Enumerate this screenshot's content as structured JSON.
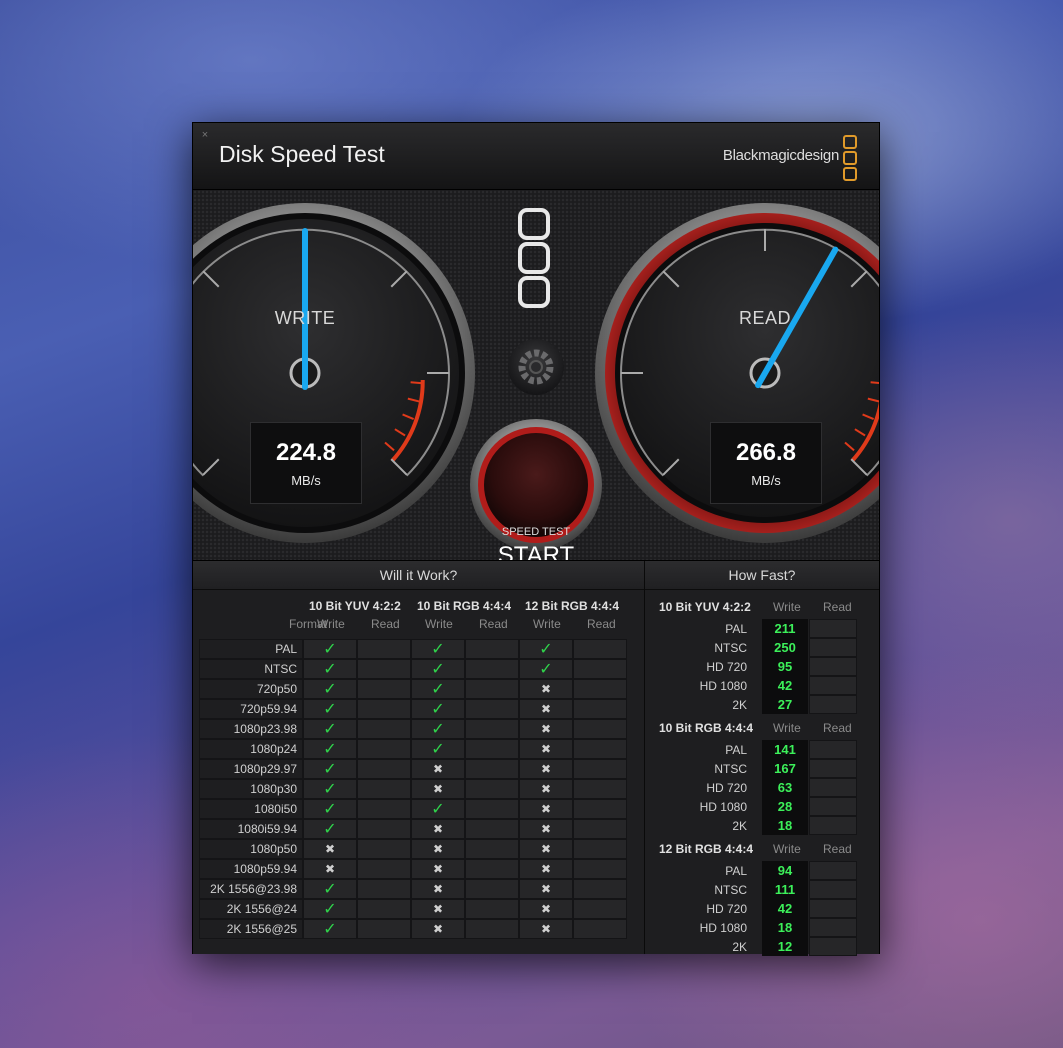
{
  "app": {
    "title": "Disk Speed Test",
    "brand": "Blackmagicdesign",
    "close_icon": "×"
  },
  "gauges": {
    "write": {
      "label": "WRITE",
      "value": "224.8",
      "unit": "MB/s",
      "needle_fraction": 0.5
    },
    "read": {
      "label": "READ",
      "value": "266.8",
      "unit": "MB/s",
      "needle_fraction": 0.61
    }
  },
  "start_button": {
    "small": "SPEED TEST",
    "big": "START"
  },
  "will_it_work": {
    "title": "Will it Work?",
    "groups": [
      "10 Bit YUV 4:2:2",
      "10 Bit RGB 4:4:4",
      "12 Bit RGB 4:4:4"
    ],
    "format_label": "Format",
    "write_label": "Write",
    "read_label": "Read",
    "rows": [
      {
        "format": "PAL",
        "results": [
          true,
          true,
          true
        ]
      },
      {
        "format": "NTSC",
        "results": [
          true,
          true,
          true
        ]
      },
      {
        "format": "720p50",
        "results": [
          true,
          true,
          false
        ]
      },
      {
        "format": "720p59.94",
        "results": [
          true,
          true,
          false
        ]
      },
      {
        "format": "1080p23.98",
        "results": [
          true,
          true,
          false
        ]
      },
      {
        "format": "1080p24",
        "results": [
          true,
          true,
          false
        ]
      },
      {
        "format": "1080p29.97",
        "results": [
          true,
          false,
          false
        ]
      },
      {
        "format": "1080p30",
        "results": [
          true,
          false,
          false
        ]
      },
      {
        "format": "1080i50",
        "results": [
          true,
          true,
          false
        ]
      },
      {
        "format": "1080i59.94",
        "results": [
          true,
          false,
          false
        ]
      },
      {
        "format": "1080p50",
        "results": [
          false,
          false,
          false
        ]
      },
      {
        "format": "1080p59.94",
        "results": [
          false,
          false,
          false
        ]
      },
      {
        "format": "2K 1556@23.98",
        "results": [
          true,
          false,
          false
        ]
      },
      {
        "format": "2K 1556@24",
        "results": [
          true,
          false,
          false
        ]
      },
      {
        "format": "2K 1556@25",
        "results": [
          true,
          false,
          false
        ]
      }
    ]
  },
  "how_fast": {
    "title": "How Fast?",
    "write_label": "Write",
    "read_label": "Read",
    "groups": [
      {
        "name": "10 Bit YUV 4:2:2",
        "rows": [
          {
            "format": "PAL",
            "write": "211"
          },
          {
            "format": "NTSC",
            "write": "250"
          },
          {
            "format": "HD 720",
            "write": "95"
          },
          {
            "format": "HD 1080",
            "write": "42"
          },
          {
            "format": "2K",
            "write": "27"
          }
        ]
      },
      {
        "name": "10 Bit RGB 4:4:4",
        "rows": [
          {
            "format": "PAL",
            "write": "141"
          },
          {
            "format": "NTSC",
            "write": "167"
          },
          {
            "format": "HD 720",
            "write": "63"
          },
          {
            "format": "HD 1080",
            "write": "28"
          },
          {
            "format": "2K",
            "write": "18"
          }
        ]
      },
      {
        "name": "12 Bit RGB 4:4:4",
        "rows": [
          {
            "format": "PAL",
            "write": "94"
          },
          {
            "format": "NTSC",
            "write": "111"
          },
          {
            "format": "HD 720",
            "write": "42"
          },
          {
            "format": "HD 1080",
            "write": "18"
          },
          {
            "format": "2K",
            "write": "12"
          }
        ]
      }
    ]
  },
  "icons": {
    "check": "✓",
    "cross": "✖",
    "settings": "gear-icon",
    "logo": "blackmagic-logo-icon"
  },
  "colors": {
    "needle": "#19a8f0",
    "check": "#2fd34b",
    "fast_value": "#3cf05a",
    "read_ring": "#c0201e",
    "redzone": "#e03a1a",
    "logo": "#e09a2a"
  }
}
